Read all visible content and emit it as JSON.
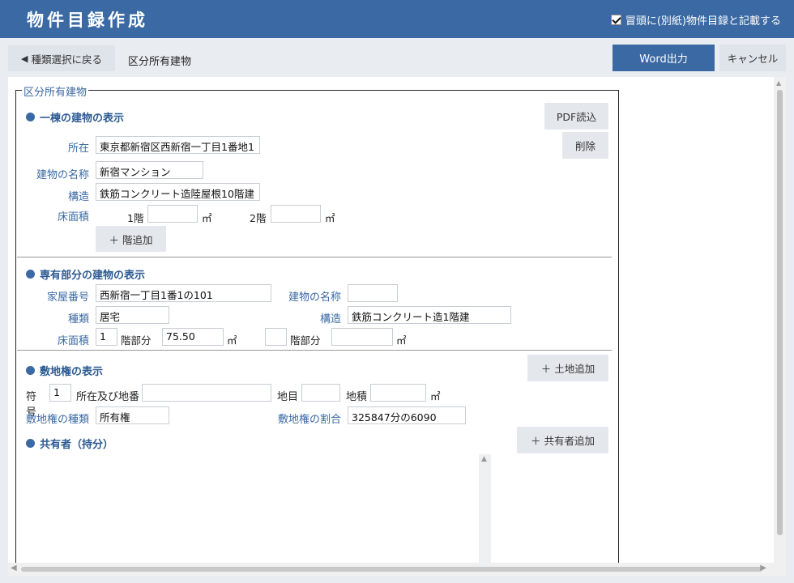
{
  "header": {
    "title": "物件目録作成",
    "checkbox_label": "冒頭に(別紙)物件目録と記載する",
    "checkbox_checked": true
  },
  "toolbar": {
    "back_label": "種類選択に戻る",
    "breadcrumb": "区分所有建物",
    "word_label": "Word出力",
    "cancel_label": "キャンセル"
  },
  "form": {
    "legend": "区分所有建物",
    "building": {
      "heading": "一棟の建物の表示",
      "pdf_label": "PDF読込",
      "delete_label": "削除",
      "location_label": "所在",
      "location_value": "東京都新宿区西新宿一丁目1番地1",
      "name_label": "建物の名称",
      "name_value": "新宿マンション",
      "structure_label": "構造",
      "structure_value": "鉄筋コンクリート造陸屋根10階建",
      "floor_area_label": "床面積",
      "floors": [
        {
          "label": "1階",
          "value": "",
          "unit": "㎡"
        },
        {
          "label": "2階",
          "value": "",
          "unit": "㎡"
        }
      ],
      "add_floor_label": "＋ 階追加"
    },
    "unit": {
      "heading": "専有部分の建物の表示",
      "house_no_label": "家屋番号",
      "house_no_value": "西新宿一丁目1番1の101",
      "name_label": "建物の名称",
      "name_value": "",
      "type_label": "種類",
      "type_value": "居宅",
      "structure_label": "構造",
      "structure_value": "鉄筋コンクリート造1階建",
      "floor_area_label": "床面積",
      "floor1_value": "1",
      "floor_part_label": "階部分",
      "area1_value": "75.50",
      "floor2_value": "",
      "area2_value": "",
      "unit": "㎡"
    },
    "land": {
      "heading": "敷地権の表示",
      "add_land_label": "＋ 土地追加",
      "symbol_label": "符号",
      "symbol_value": "1",
      "address_label": "所在及び地番",
      "address_value": "",
      "category_label": "地目",
      "category_value": "",
      "area_label": "地積",
      "area_value": "",
      "unit": "㎡",
      "right_type_label": "敷地権の種類",
      "right_type_value": "所有権",
      "right_ratio_label": "敷地権の割合",
      "right_ratio_value": "325847分の6090"
    },
    "owners": {
      "heading": "共有者（持分）",
      "add_owner_label": "＋ 共有者追加"
    }
  },
  "icons": {
    "back": "triangle-left-icon",
    "check": "check-icon",
    "scroll_up": "arrow-up-icon",
    "scroll_down": "arrow-down-icon",
    "scroll_left": "arrow-left-icon",
    "scroll_right": "arrow-right-icon"
  },
  "colors": {
    "header_bg": "#3a69a3",
    "accent": "#3a69a3",
    "button_light": "#dfe4ea"
  }
}
